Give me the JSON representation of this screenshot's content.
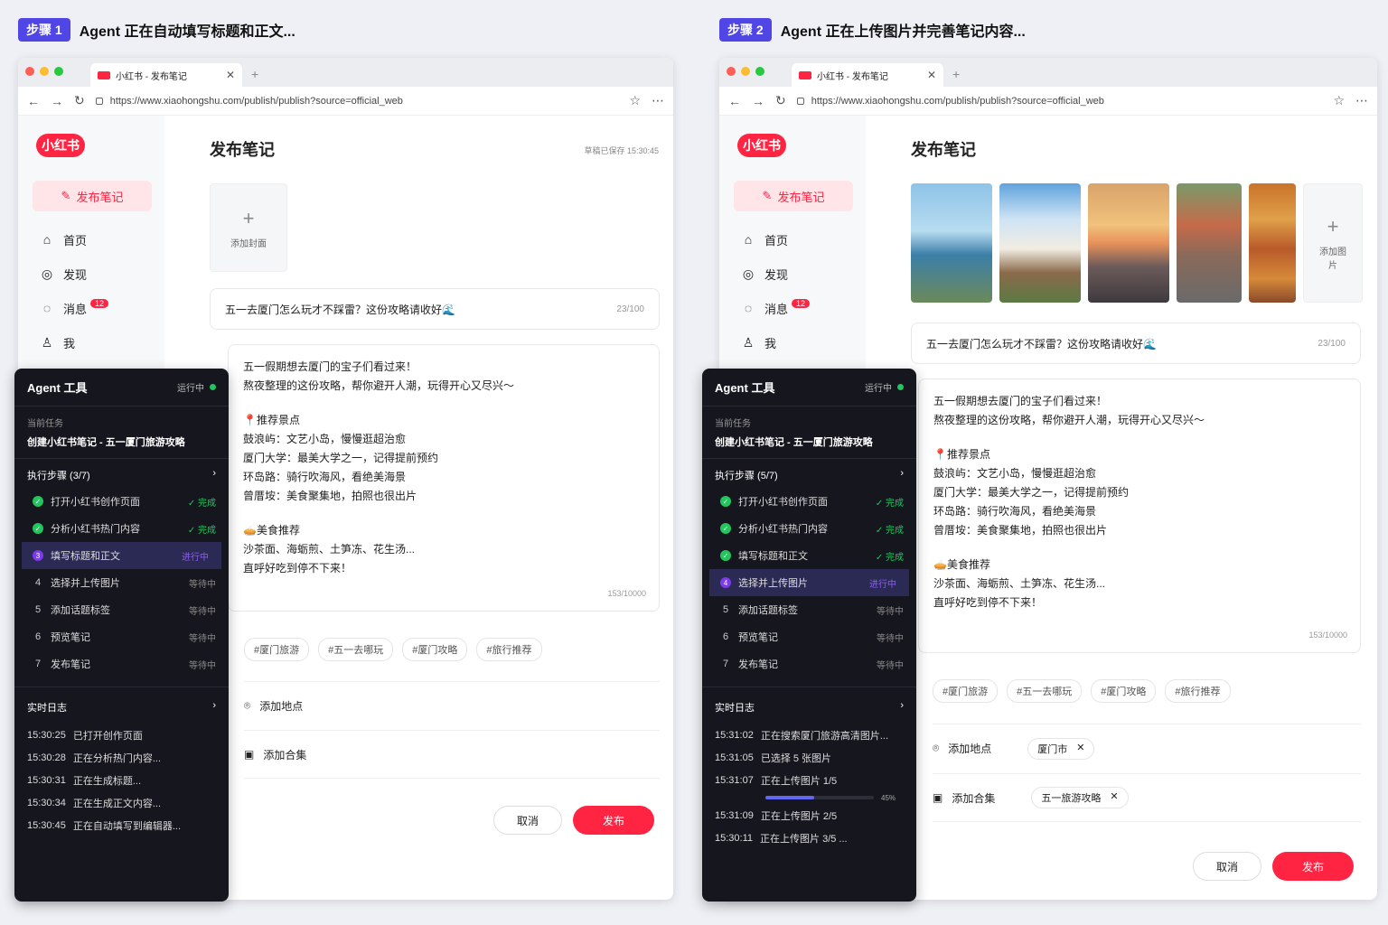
{
  "step1": {
    "badge": "步骤 1",
    "title": "Agent 正在自动填写标题和正文...",
    "browser": {
      "tab_title": "小红书 - 发布笔记",
      "url": "https://www.xiaohongshu.com/publish/publish?source=official_web"
    },
    "sidebar": {
      "logo": "小红书",
      "publish_label": "发布笔记",
      "items": [
        {
          "label": "首页"
        },
        {
          "label": "发现"
        },
        {
          "label": "消息",
          "badge": "12"
        },
        {
          "label": "我"
        }
      ]
    },
    "main": {
      "title": "发布笔记",
      "saved": "草稿已保存 15:30:45",
      "cover_label": "添加封面",
      "note_title": "五一去厦门怎么玩才不踩雷？这份攻略请收好🌊",
      "title_count": "23/100",
      "body_lines": [
        "五一假期想去厦门的宝子们看过来！",
        "熬夜整理的这份攻略，帮你避开人潮，玩得开心又尽兴～",
        "",
        "📍推荐景点",
        "鼓浪屿：文艺小岛，慢慢逛超治愈",
        "厦门大学：最美大学之一，记得提前预约",
        "环岛路：骑行吹海风，看绝美海景",
        "曾厝垵：美食聚集地，拍照也很出片",
        "",
        "🥧美食推荐",
        "沙茶面、海蛎煎、土笋冻、花生汤...",
        "直呼好吃到停不下来！"
      ],
      "body_count": "153/10000",
      "tags": [
        "#厦门旅游",
        "#五一去哪玩",
        "#厦门攻略",
        "#旅行推荐"
      ],
      "location_label": "添加地点",
      "collection_label": "添加合集",
      "cancel": "取消",
      "publish": "发布"
    },
    "agent": {
      "title": "Agent 工具",
      "status": "运行中",
      "task_label": "当前任务",
      "task": "创建小红书笔记 - 五一厦门旅游攻略",
      "steps_header": "执行步骤 (3/7)",
      "steps": [
        {
          "num": "1",
          "label": "打开小红书创作页面",
          "state": "✓ 完成",
          "kind": "done"
        },
        {
          "num": "2",
          "label": "分析小红书热门内容",
          "state": "✓ 完成",
          "kind": "done"
        },
        {
          "num": "3",
          "label": "填写标题和正文",
          "state": "进行中",
          "kind": "run"
        },
        {
          "num": "4",
          "label": "选择并上传图片",
          "state": "等待中",
          "kind": "wait"
        },
        {
          "num": "5",
          "label": "添加话题标签",
          "state": "等待中",
          "kind": "wait"
        },
        {
          "num": "6",
          "label": "预览笔记",
          "state": "等待中",
          "kind": "wait"
        },
        {
          "num": "7",
          "label": "发布笔记",
          "state": "等待中",
          "kind": "wait"
        }
      ],
      "log_header": "实时日志",
      "logs": [
        {
          "time": "15:30:25",
          "text": "已打开创作页面"
        },
        {
          "time": "15:30:28",
          "text": "正在分析热门内容..."
        },
        {
          "time": "15:30:31",
          "text": "正在生成标题..."
        },
        {
          "time": "15:30:34",
          "text": "正在生成正文内容..."
        },
        {
          "time": "15:30:45",
          "text": "正在自动填写到编辑器..."
        }
      ]
    }
  },
  "step2": {
    "badge": "步骤 2",
    "title": "Agent 正在上传图片并完善笔记内容...",
    "browser": {
      "tab_title": "小红书 - 发布笔记",
      "url": "https://www.xiaohongshu.com/publish/publish?source=official_web"
    },
    "sidebar": {
      "logo": "小红书",
      "publish_label": "发布笔记",
      "items": [
        {
          "label": "首页"
        },
        {
          "label": "发现"
        },
        {
          "label": "消息",
          "badge": "12"
        },
        {
          "label": "我"
        }
      ]
    },
    "main": {
      "title": "发布笔记",
      "add_image_label": "添加图片",
      "note_title": "五一去厦门怎么玩才不踩雷？这份攻略请收好🌊",
      "title_count": "23/100",
      "body_lines": [
        "五一假期想去厦门的宝子们看过来！",
        "熬夜整理的这份攻略，帮你避开人潮，玩得开心又尽兴～",
        "",
        "📍推荐景点",
        "鼓浪屿：文艺小岛，慢慢逛超治愈",
        "厦门大学：最美大学之一，记得提前预约",
        "环岛路：骑行吹海风，看绝美海景",
        "曾厝垵：美食聚集地，拍照也很出片",
        "",
        "🥧美食推荐",
        "沙茶面、海蛎煎、土笋冻、花生汤...",
        "直呼好吃到停不下来！"
      ],
      "body_count": "153/10000",
      "tags": [
        "#厦门旅游",
        "#五一去哪玩",
        "#厦门攻略",
        "#旅行推荐"
      ],
      "location_label": "添加地点",
      "location_value": "厦门市",
      "collection_label": "添加合集",
      "collection_value": "五一旅游攻略",
      "cancel": "取消",
      "publish": "发布"
    },
    "agent": {
      "title": "Agent 工具",
      "status": "运行中",
      "task_label": "当前任务",
      "task": "创建小红书笔记 - 五一厦门旅游攻略",
      "steps_header": "执行步骤 (5/7)",
      "steps": [
        {
          "num": "1",
          "label": "打开小红书创作页面",
          "state": "✓ 完成",
          "kind": "done"
        },
        {
          "num": "2",
          "label": "分析小红书热门内容",
          "state": "✓ 完成",
          "kind": "done"
        },
        {
          "num": "3",
          "label": "填写标题和正文",
          "state": "✓ 完成",
          "kind": "done"
        },
        {
          "num": "4",
          "label": "选择并上传图片",
          "state": "进行中",
          "kind": "run"
        },
        {
          "num": "5",
          "label": "添加话题标签",
          "state": "等待中",
          "kind": "wait"
        },
        {
          "num": "6",
          "label": "预览笔记",
          "state": "等待中",
          "kind": "wait"
        },
        {
          "num": "7",
          "label": "发布笔记",
          "state": "等待中",
          "kind": "wait"
        }
      ],
      "log_header": "实时日志",
      "logs": [
        {
          "time": "15:31:02",
          "text": "正在搜索厦门旅游高清图片..."
        },
        {
          "time": "15:31:05",
          "text": "已选择 5 张图片"
        },
        {
          "time": "15:31:07",
          "text": "正在上传图片 1/5"
        },
        {
          "time": "15:31:09",
          "text": "正在上传图片 2/5"
        },
        {
          "time": "15:30:11",
          "text": "正在上传图片 3/5 ..."
        }
      ],
      "upload_progress_pct": 45,
      "upload_progress_text": "45%"
    }
  },
  "colors": {
    "brand": "#ff2442",
    "accent": "#4f46e5",
    "success": "#22c55e",
    "running": "#7c3aed"
  }
}
